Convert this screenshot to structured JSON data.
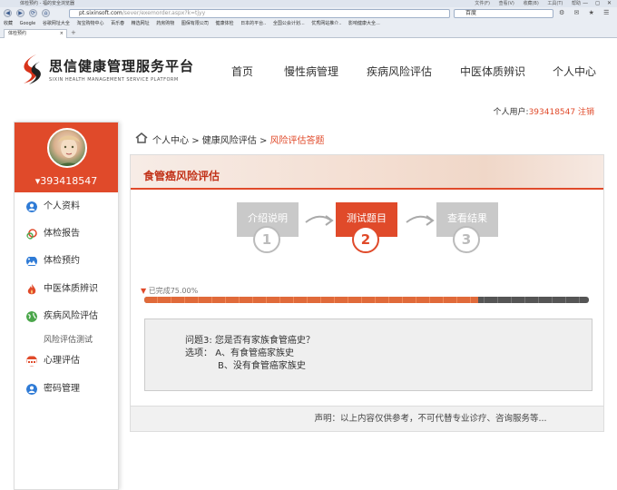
{
  "browser": {
    "window_title": "体检预约 - 福的安全浏览器",
    "menus": [
      "文件(F)",
      "查看(V)",
      "收藏(B)",
      "工具(T)",
      "帮助"
    ],
    "window_controls": "— ◻ ✕",
    "url_prefix": "pt.sixinsoft.com",
    "url_path": "/sever/exemorder.aspx?k=tjyy",
    "search_engine": "百度",
    "favorites": [
      "收藏",
      "Google",
      "谷歌网址大全",
      "淘宝购物中心",
      "百乐春",
      "精选网址",
      "药房购物",
      "图保有限公司",
      "健康体检",
      "日本的平台..",
      "全国公会计划...",
      "优秀网站推介..",
      "影响健康大全..."
    ],
    "tab_label": "体检预约",
    "tab_close": "×",
    "new_tab": "+",
    "nav_glyphs": [
      "◀",
      "▶",
      "⟳",
      "⌂"
    ],
    "tool_glyphs": "⚙ ✉ ★ ☰"
  },
  "site": {
    "logo_cn": "思信健康管理服务平台",
    "logo_en": "SIXIN HEALTH MANAGEMENT SERVICE PLATFORM",
    "nav": [
      "首页",
      "慢性病管理",
      "疾病风险评估",
      "中医体质辨识",
      "个人中心"
    ],
    "user_label": "个人用户:",
    "user_id": "393418547",
    "logout": "注销"
  },
  "sidebar": {
    "username": "▾393418547",
    "items": [
      {
        "label": "个人资料",
        "icon": "person-icon",
        "color": "#2f7bd6"
      },
      {
        "label": "体检报告",
        "icon": "report-icon",
        "color": "#e04a2a"
      },
      {
        "label": "体检预约",
        "icon": "image-icon",
        "color": "#2f7bd6"
      },
      {
        "label": "中医体质辨识",
        "icon": "flame-icon",
        "color": "#e04a2a"
      },
      {
        "label": "疾病风险评估",
        "icon": "globe-icon",
        "color": "#4aa64a"
      },
      {
        "label": "风险评估测试",
        "icon": "",
        "color": ""
      },
      {
        "label": "心理评估",
        "icon": "calendar-icon",
        "color": "#e04a2a"
      },
      {
        "label": "密码管理",
        "icon": "lock-person-icon",
        "color": "#2f7bd6"
      }
    ]
  },
  "breadcrumb": {
    "home": "个人中心",
    "sep": ">",
    "middle": "健康风险评估",
    "current": "风险评估答题"
  },
  "assessment": {
    "title": "食管癌风险评估",
    "steps": [
      {
        "label": "介绍说明",
        "num": "1",
        "active": false
      },
      {
        "label": "测试题目",
        "num": "2",
        "active": true
      },
      {
        "label": "查看结果",
        "num": "3",
        "active": false
      }
    ],
    "progress_text": "已完成75.00%",
    "progress": 0.75,
    "question_label": "问题3:",
    "question": "您是否有家族食管癌史？",
    "options_label": "选项：",
    "options": [
      "A、有食管癌家族史",
      "B、没有食管癌家族史"
    ],
    "disclaimer": "声明：以上内容仅供参考，不可代替专业诊疗、咨询服务等..."
  },
  "colors": {
    "accent": "#e04a2a",
    "step_inactive": "#c9c9c9"
  }
}
